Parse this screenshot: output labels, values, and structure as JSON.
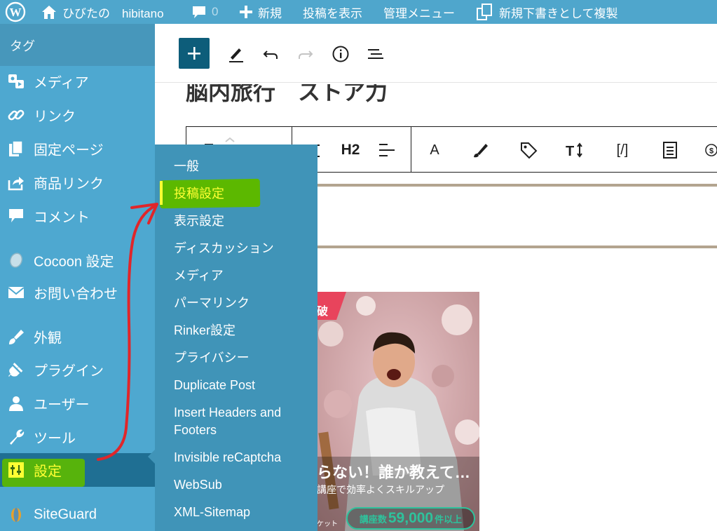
{
  "admin_bar": {
    "site_name": "ひびたの　hibitano",
    "comments_count": "0",
    "new_label": "新規",
    "view_post_label": "投稿を表示",
    "admin_menu_label": "管理メニュー",
    "duplicate_label": "新規下書きとして複製"
  },
  "sidebar": {
    "tag_label": "タグ",
    "items": [
      {
        "label": "メディア",
        "icon": "media-icon"
      },
      {
        "label": "リンク",
        "icon": "link-icon"
      },
      {
        "label": "固定ページ",
        "icon": "page-icon"
      },
      {
        "label": "商品リンク",
        "icon": "share-icon"
      },
      {
        "label": "コメント",
        "icon": "comment-icon"
      },
      {
        "label": "Cocoon 設定",
        "icon": "cocoon-icon"
      },
      {
        "label": "お問い合わせ",
        "icon": "mail-icon"
      },
      {
        "label": "外観",
        "icon": "brush-icon"
      },
      {
        "label": "プラグイン",
        "icon": "plugin-icon"
      },
      {
        "label": "ユーザー",
        "icon": "user-icon"
      },
      {
        "label": "ツール",
        "icon": "wrench-icon"
      },
      {
        "label": "設定",
        "icon": "settings-icon"
      },
      {
        "label": "SiteGuard",
        "icon": "siteguard-icon"
      }
    ]
  },
  "submenu": {
    "items": [
      "一般",
      "投稿設定",
      "表示設定",
      "ディスカッション",
      "メディア",
      "パーマリンク",
      "Rinker設定",
      "プライバシー",
      "Duplicate Post",
      "Insert Headers and",
      "Footers",
      "Invisible reCaptcha",
      "WebSub",
      "XML-Sitemap"
    ]
  },
  "editor": {
    "title": "脳内旅行　ストア力",
    "heading_level": "H2",
    "text_icon": "A",
    "shortcode_icon": "[/]"
  },
  "ad": {
    "badge": "破",
    "headline": "らない！誰か教えて…",
    "subline": "講座で効率よくスキルアップ",
    "small": "ケット",
    "count_prefix": "講座数",
    "count": "59,000",
    "count_suffix": "件以上"
  },
  "colors": {
    "admin_bar": "#4fa6cc",
    "sidebar": "#4ea8d0",
    "submenu": "#4094b8",
    "highlight": "#5cb800",
    "accent_yellow": "#ffff33",
    "annotation_red": "#e0262a"
  }
}
